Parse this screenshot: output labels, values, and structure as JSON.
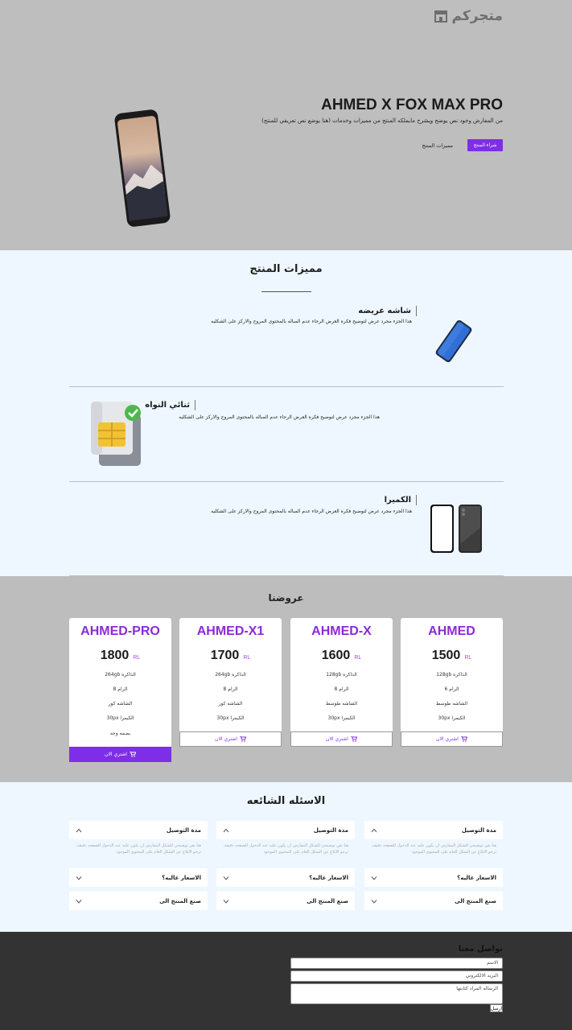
{
  "header": {
    "brand_name": "متجركم",
    "brand_icon": "store-icon"
  },
  "hero": {
    "title": "AHMED X FOX MAX PRO",
    "description": "من المفارض وجود نص يوضح ويشرح مايملكه المنتج من مميزات وخدمات (هنا يوضع نص تعريفي للمنتج)",
    "buy_label": "شراء المنتج",
    "features_label": "مميزات المنتج"
  },
  "features": {
    "title": "مميزات المنتج",
    "items": [
      {
        "title": "شاشه عريضه",
        "desc": "هذا الجزء مجرد عرض لتوضيح فكره العرض الرجاء عدم المباله بالمحتوى المروج والاركز على الشكليه",
        "icon": "phone-icon"
      },
      {
        "title": "ثنائي النواه",
        "desc": "هذا الجزء مجرد عرض لتوضيح فكره العرض الرجاء عدم المباله بالمحتوى المروج والاركز على الشكليه",
        "icon": "sim-card-icon"
      },
      {
        "title": "الكميرا",
        "desc": "هذا الجزء مجرد عرض لتوضيح فكره العرض الرجاء عدم المباله بالمحتوى المروج والاركز على الشكليه",
        "icon": "two-phones-icon"
      }
    ]
  },
  "offers": {
    "title": "عروضنا",
    "currency": "RL",
    "buy_label": "اشتري الان",
    "cards": [
      {
        "name": "AHMED",
        "price": "1500",
        "features": [
          "الذاكره 128gb",
          "الرام 6",
          "الشاشه طوسط",
          "الكيمرا 30px"
        ]
      },
      {
        "name": "AHMED-X",
        "price": "1600",
        "features": [
          "الذاكره 128gb",
          "الرام 8",
          "الشاشه طوسط",
          "الكيمرا 30px"
        ]
      },
      {
        "name": "AHMED-X1",
        "price": "1700",
        "features": [
          "الذاكره 264gb",
          "الرام 8",
          "الشاشه كور",
          "الكيمرا 30px"
        ]
      },
      {
        "name": "AHMED-PRO",
        "price": "1800",
        "features": [
          "الذاكره 264gb",
          "الرام 8",
          "الشاشه كور",
          "الكيمرا 30px",
          "بصمه وجه"
        ]
      }
    ]
  },
  "faq": {
    "title": "الاسئله الشائعه",
    "columns": [
      {
        "q1": "مدة التوصيل",
        "a1": "هنا نص توضيحي للشكل المفارض ان يكون عليه عند الدخول للصفحه دقيقه، ترجو الابلاغ عن الشكل العام على المحتوى الموجود",
        "q2": "الاسعار غاليه؟",
        "q3": "صنع المنتج الى"
      },
      {
        "q1": "مدة التوصيل",
        "a1": "هنا نص توضيحي للشكل المفارض ان يكون عليه عند الدخول للصفحه دقيقه، ترجو الابلاغ عن الشكل العام على المحتوى الموجود",
        "q2": "الاسعار غاليه؟",
        "q3": "صنع المنتج الى"
      },
      {
        "q1": "مدة التوصيل",
        "a1": "هنا نص توضيحي للشكل المفارض ان يكون عليه عند الدخول للصفحه دقيقه، ترجو الابلاغ عن الشكل العام على المحتوى الموجود",
        "q2": "الاسعار غاليه؟",
        "q3": "صنع المنتج الى"
      }
    ]
  },
  "contact": {
    "title": "تواصل معنا",
    "name_placeholder": "الاسم",
    "email_placeholder": "البريد الالكتروني",
    "message_placeholder": "الرساله المراد كتابتها",
    "send_label": "ارسل"
  },
  "colors": {
    "accent": "#7e2ee6",
    "hero_bg": "#bebebe",
    "light_bg": "#eef7ff",
    "footer_bg": "#333333"
  }
}
